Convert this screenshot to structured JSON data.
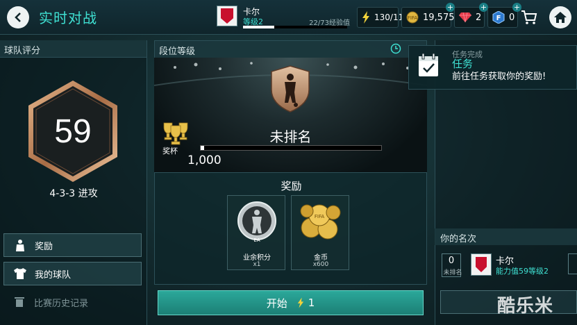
{
  "header": {
    "title": "实时对战",
    "profile": {
      "name": "卡尔",
      "level": "等级2",
      "xp_text": "22/73经验值",
      "xp_progress": 0.3
    },
    "resources": {
      "energy": "130/11",
      "coins": "19,575",
      "gems": "2",
      "points": "0"
    }
  },
  "left": {
    "header": "球队评分",
    "rating": "59",
    "formation": "4-3-3 进攻",
    "buttons": {
      "rewards": "奖励",
      "my_team": "我的球队",
      "history": "比赛历史记录"
    }
  },
  "center": {
    "header": "段位等级",
    "rank_name": "未排名",
    "trophy_label": "奖杯",
    "trophy_value": "1,000",
    "trophy_progress": 0.02,
    "rewards_title": "奖励",
    "rewards": [
      {
        "label": "业余积分",
        "qty": "x1"
      },
      {
        "label": "金币",
        "qty": "x600"
      }
    ],
    "start_label": "开始",
    "start_cost": "1"
  },
  "task": {
    "complete": "任务完成",
    "title": "任务",
    "desc": "前往任务获取你的奖励!"
  },
  "ranking": {
    "header": "你的名次",
    "rank": "0",
    "rank_sub": "未排名",
    "player": "卡尔",
    "ability": "能力值59等级2"
  },
  "watermark": "酷乐米",
  "colors": {
    "accent": "#3fe0d2",
    "start_button": "#2ba89a"
  }
}
